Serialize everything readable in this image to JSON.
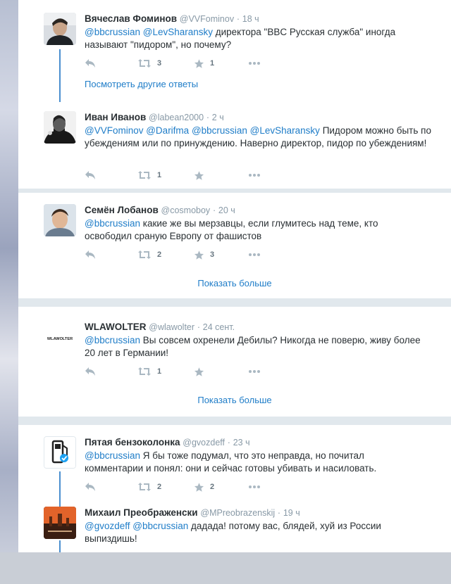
{
  "conversations": [
    {
      "tweets": [
        {
          "name": "Вячеслав Фоминов",
          "handle": "@VVFominov",
          "time": "18 ч",
          "mentions": "@bbcrussian @LevSharansky",
          "text": " директора \"BBC Русская служба\" иногда называют \"пидором\", но почему?",
          "retweets": "3",
          "likes": "1"
        }
      ],
      "more_replies_label": "Посмотреть другие ответы"
    },
    {
      "tweets": [
        {
          "name": "Иван Иванов",
          "handle": "@labean2000",
          "time": "2 ч",
          "mentions": "@VVFominov @Darifma @bbcrussian @LevSharansky",
          "text": " Пидором можно быть по убеждениям или по принуждению. Наверно директор, пидор по убеждениям!",
          "retweets": "1",
          "likes": ""
        }
      ]
    },
    {
      "tweets": [
        {
          "name": "Семён Лобанов",
          "handle": "@cosmoboy",
          "time": "20 ч",
          "mentions": "@bbcrussian",
          "text": " какие же вы мерзавцы, если глумитесь над теме, кто освободил сраную Европу от фашистов",
          "retweets": "2",
          "likes": "3"
        }
      ],
      "show_more_label": "Показать больше"
    },
    {
      "tweets": [
        {
          "name": "WLAWOLTER",
          "handle": "@wlawolter",
          "time": "24 сент.",
          "avatar_text": "WLAWOLTER",
          "mentions": "@bbcrussian",
          "text": " Вы совсем охренели Дебилы? Никогда не поверю, живу более 20 лет в Германии!",
          "retweets": "1",
          "likes": ""
        }
      ],
      "show_more_label": "Показать больше"
    },
    {
      "tweets": [
        {
          "name": "Пятая бензоколонка",
          "handle": "@gvozdeff",
          "time": "23 ч",
          "mentions": "@bbcrussian",
          "text": " Я бы тоже подумал, что это неправда, но почитал комментарии и понял: они и сейчас готовы убивать и насиловать.",
          "retweets": "2",
          "likes": "2"
        },
        {
          "name": "Михаил Преображенски",
          "handle": "@MPreobrazenskij",
          "time": "19 ч",
          "mentions": "@gvozdeff @bbcrussian",
          "text": " дадада! потому вас, блядей, хуй из России выпиздишь!",
          "retweets": "",
          "likes": ""
        }
      ]
    }
  ],
  "ui": {
    "dot": "·",
    "more_icon": "more-horizontal-icon",
    "link_color": "#1f7dc8",
    "thread_line_color": "#4a8fcf",
    "name_color": "#292f33",
    "meta_color": "#8899a6"
  }
}
